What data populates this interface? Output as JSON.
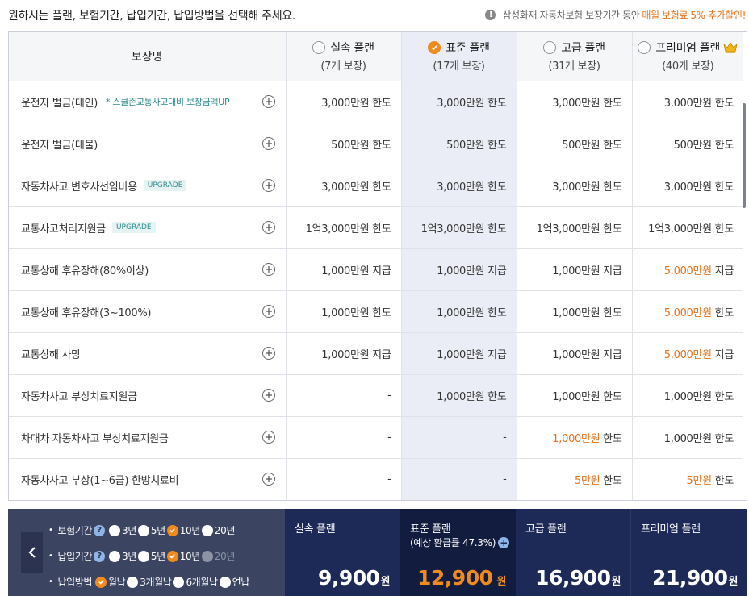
{
  "header": {
    "instruction": "원하시는 플랜, 보험기간, 납입기간, 납입방법을 선택해 주세요.",
    "notice_prefix": "삼성화재 자동차보험 보장기간 동안",
    "notice_highlight": "매월 보험료 5% 추가할인!"
  },
  "table": {
    "name_header": "보장명",
    "plans": [
      {
        "name": "실속 플랜",
        "count": "(7개 보장)",
        "selected": false
      },
      {
        "name": "표준 플랜",
        "count": "(17개 보장)",
        "selected": true
      },
      {
        "name": "고급 플랜",
        "count": "(31개 보장)",
        "selected": false
      },
      {
        "name": "프리미엄 플랜",
        "count": "(40개 보장)",
        "selected": false
      }
    ],
    "rows": [
      {
        "name": "운전자 벌금(대인)",
        "note": "* 스쿨존교통사고대비 보장금액UP",
        "badge": "",
        "cells": [
          {
            "amt": "3,000만원",
            "unit": " 한도",
            "hl": false
          },
          {
            "amt": "3,000만원",
            "unit": " 한도",
            "hl": false
          },
          {
            "amt": "3,000만원",
            "unit": " 한도",
            "hl": false
          },
          {
            "amt": "3,000만원",
            "unit": " 한도",
            "hl": false
          }
        ]
      },
      {
        "name": "운전자 벌금(대물)",
        "note": "",
        "badge": "",
        "cells": [
          {
            "amt": "500만원",
            "unit": " 한도",
            "hl": false
          },
          {
            "amt": "500만원",
            "unit": " 한도",
            "hl": false
          },
          {
            "amt": "500만원",
            "unit": " 한도",
            "hl": false
          },
          {
            "amt": "500만원",
            "unit": " 한도",
            "hl": false
          }
        ]
      },
      {
        "name": "자동차사고 변호사선임비용",
        "note": "",
        "badge": "UPGRADE",
        "cells": [
          {
            "amt": "3,000만원",
            "unit": " 한도",
            "hl": false
          },
          {
            "amt": "3,000만원",
            "unit": " 한도",
            "hl": false
          },
          {
            "amt": "3,000만원",
            "unit": " 한도",
            "hl": false
          },
          {
            "amt": "3,000만원",
            "unit": " 한도",
            "hl": false
          }
        ]
      },
      {
        "name": "교통사고처리지원금",
        "note": "",
        "badge": "UPGRADE",
        "cells": [
          {
            "amt": "1억3,000만원",
            "unit": " 한도",
            "hl": false
          },
          {
            "amt": "1억3,000만원",
            "unit": " 한도",
            "hl": false
          },
          {
            "amt": "1억3,000만원",
            "unit": " 한도",
            "hl": false
          },
          {
            "amt": "1억3,000만원",
            "unit": " 한도",
            "hl": false
          }
        ]
      },
      {
        "name": "교통상해 후유장해(80%이상)",
        "note": "",
        "badge": "",
        "cells": [
          {
            "amt": "1,000만원",
            "unit": " 지급",
            "hl": false
          },
          {
            "amt": "1,000만원",
            "unit": " 지급",
            "hl": false
          },
          {
            "amt": "1,000만원",
            "unit": " 지급",
            "hl": false
          },
          {
            "amt": "5,000만원",
            "unit": " 지급",
            "hl": true
          }
        ]
      },
      {
        "name": "교통상해 후유장해(3~100%)",
        "note": "",
        "badge": "",
        "cells": [
          {
            "amt": "1,000만원",
            "unit": " 한도",
            "hl": false
          },
          {
            "amt": "1,000만원",
            "unit": " 한도",
            "hl": false
          },
          {
            "amt": "1,000만원",
            "unit": " 한도",
            "hl": false
          },
          {
            "amt": "5,000만원",
            "unit": " 한도",
            "hl": true
          }
        ]
      },
      {
        "name": "교통상해 사망",
        "note": "",
        "badge": "",
        "cells": [
          {
            "amt": "1,000만원",
            "unit": " 지급",
            "hl": false
          },
          {
            "amt": "1,000만원",
            "unit": " 지급",
            "hl": false
          },
          {
            "amt": "1,000만원",
            "unit": " 지급",
            "hl": false
          },
          {
            "amt": "5,000만원",
            "unit": " 지급",
            "hl": true
          }
        ]
      },
      {
        "name": "자동차사고 부상치료지원금",
        "note": "",
        "badge": "",
        "cells": [
          {
            "amt": "-",
            "unit": "",
            "hl": false
          },
          {
            "amt": "1,000만원",
            "unit": " 한도",
            "hl": false
          },
          {
            "amt": "1,000만원",
            "unit": " 한도",
            "hl": false
          },
          {
            "amt": "1,000만원",
            "unit": " 한도",
            "hl": false
          }
        ]
      },
      {
        "name": "차대차 자동차사고 부상치료지원금",
        "note": "",
        "badge": "",
        "cells": [
          {
            "amt": "-",
            "unit": "",
            "hl": false
          },
          {
            "amt": "-",
            "unit": "",
            "hl": false
          },
          {
            "amt": "1,000만원",
            "unit": " 한도",
            "hl": true
          },
          {
            "amt": "1,000만원",
            "unit": " 한도",
            "hl": false
          }
        ]
      },
      {
        "name": "자동차사고 부상(1~6급) 한방치료비",
        "note": "",
        "badge": "",
        "cells": [
          {
            "amt": "-",
            "unit": "",
            "hl": false
          },
          {
            "amt": "-",
            "unit": "",
            "hl": false
          },
          {
            "amt": "5만원",
            "unit": " 한도",
            "hl": true
          },
          {
            "amt": "5만원",
            "unit": " 한도",
            "hl": true
          }
        ]
      }
    ]
  },
  "options": {
    "groups": [
      {
        "label": "보험기간",
        "help": true,
        "choices": [
          {
            "text": "3년",
            "state": "off"
          },
          {
            "text": "5년",
            "state": "off"
          },
          {
            "text": "10년",
            "state": "on"
          },
          {
            "text": "20년",
            "state": "off"
          }
        ]
      },
      {
        "label": "납입기간",
        "help": true,
        "choices": [
          {
            "text": "3년",
            "state": "off"
          },
          {
            "text": "5년",
            "state": "off"
          },
          {
            "text": "10년",
            "state": "on"
          },
          {
            "text": "20년",
            "state": "disabled"
          }
        ]
      },
      {
        "label": "납입방법",
        "help": false,
        "choices": [
          {
            "text": "월납",
            "state": "on"
          },
          {
            "text": "3개월납",
            "state": "off"
          },
          {
            "text": "6개월납",
            "state": "off"
          },
          {
            "text": "연납",
            "state": "off"
          }
        ]
      }
    ]
  },
  "prices": [
    {
      "name": "실속 플랜",
      "sub": "",
      "amount": "9,900",
      "unit": "원"
    },
    {
      "name": "표준 플랜",
      "sub": "(예상 환급률 47.3%)",
      "amount": "12,900",
      "unit": " 원"
    },
    {
      "name": "고급 플랜",
      "sub": "",
      "amount": "16,900",
      "unit": "원"
    },
    {
      "name": "프리미엄 플랜",
      "sub": "",
      "amount": "21,900",
      "unit": "원"
    }
  ],
  "colors": {
    "accent": "#ef8a1c",
    "highlight_text": "#e6741c",
    "navy": "#1d2a57",
    "panel": "#3b4461"
  }
}
